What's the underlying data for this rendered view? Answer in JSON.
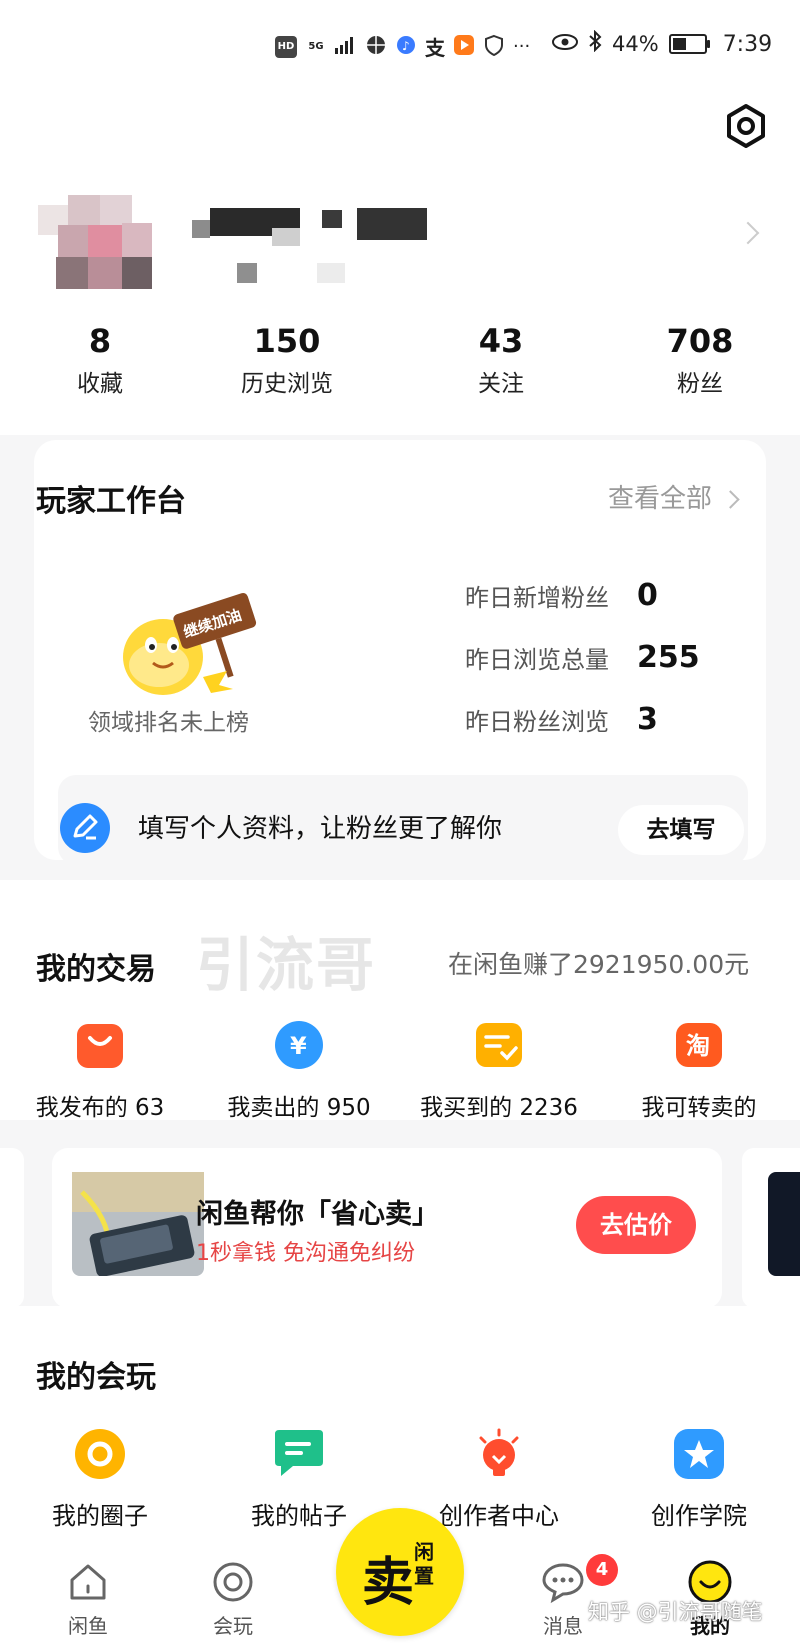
{
  "status_bar": {
    "left_icons": [
      "HD",
      "5G",
      "signal-icon",
      "basketball-icon",
      "music-icon",
      "alipay-icon",
      "video-icon",
      "shield-icon",
      "···"
    ],
    "battery": "44%",
    "battery_level": 0.44,
    "time": "7:39"
  },
  "profile": {
    "settings_icon": "gear-icon"
  },
  "stats": [
    {
      "value": "8",
      "label": "收藏"
    },
    {
      "value": "150",
      "label": "历史浏览"
    },
    {
      "value": "43",
      "label": "关注"
    },
    {
      "value": "708",
      "label": "粉丝"
    }
  ],
  "workbench": {
    "title": "玩家工作台",
    "see_all": "查看全部",
    "mascot_sign": "继续加油",
    "rank_text": "领域排名未上榜",
    "metrics": [
      {
        "label": "昨日新增粉丝",
        "value": "0"
      },
      {
        "label": "昨日浏览总量",
        "value": "255"
      },
      {
        "label": "昨日粉丝浏览",
        "value": "3"
      }
    ],
    "tip_text": "填写个人资料，让粉丝更了解你",
    "tip_button": "去填写"
  },
  "trade": {
    "title": "我的交易",
    "watermark": "引流哥",
    "earned": "在闲鱼赚了2921950.00元",
    "items": [
      {
        "label": "我发布的 63",
        "icon": "shopping-bag-icon",
        "color": "#ff5a2c"
      },
      {
        "label": "我卖出的 950",
        "icon": "yuan-coin-icon",
        "color": "#2f9bff"
      },
      {
        "label": "我买到的 2236",
        "icon": "checklist-icon",
        "color": "#ffb000"
      },
      {
        "label": "我可转卖的",
        "icon": "taobao-icon",
        "color": "#ff5a1f"
      }
    ]
  },
  "banner": {
    "title": "闲鱼帮你「省心卖」",
    "subtitle": "1秒拿钱 免沟通免纠纷",
    "button": "去估价"
  },
  "play": {
    "title": "我的会玩",
    "items": [
      {
        "label": "我的圈子",
        "icon": "circle-ring-icon",
        "color": "#ffb400"
      },
      {
        "label": "我的帖子",
        "icon": "post-icon",
        "color": "#1fc08a"
      },
      {
        "label": "创作者中心",
        "icon": "lightbulb-icon",
        "color": "#ff4d2e"
      },
      {
        "label": "创作学院",
        "icon": "star-icon",
        "color": "#2f9bff"
      }
    ]
  },
  "tabbar": {
    "tabs": [
      {
        "label": "闲鱼",
        "icon": "home-icon"
      },
      {
        "label": "会玩",
        "icon": "target-icon"
      },
      {
        "label": "消息",
        "icon": "chat-icon"
      },
      {
        "label": "我的",
        "icon": "smiley-icon"
      }
    ],
    "sell_main": "卖",
    "sell_sub": "闲置",
    "message_badge": "4"
  },
  "watermark_bottom": "知乎 @引流哥随笔"
}
